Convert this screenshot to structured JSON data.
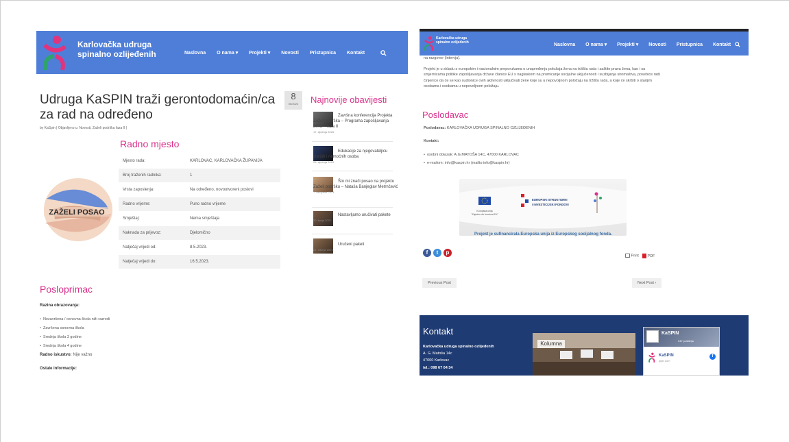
{
  "left": {
    "brand": {
      "line1": "Karlovačka udruga",
      "line2": "spinalno ozlijeđenih"
    },
    "nav": [
      "Naslovna",
      "O nama ▾",
      "Projekti ▾",
      "Novosti",
      "Pristupnica",
      "Kontakt"
    ],
    "title": "Udruga KaSPIN traži gerontodomaćin/ca za rad na određeno",
    "date_day": "8",
    "date_month": "05/2023",
    "meta": "by KaSpin | Objavljeno u: Novosti, Zaželi podrška faza II |",
    "section1": "Radno mjesto",
    "zazeli": "ZAŽELI POSAO",
    "table": [
      {
        "k": "Mjesto rada:",
        "v": "KARLOVAC, KARLOVAČKA ŽUPANIJA"
      },
      {
        "k": "Broj traženih radnika:",
        "v": "1"
      },
      {
        "k": "Vrsta zaposlenja:",
        "v": "Na određeno, novootvoreni poslovi"
      },
      {
        "k": "Radno vrijeme:",
        "v": "Puno radno vrijeme"
      },
      {
        "k": "Smještaj:",
        "v": "Nema smještaja"
      },
      {
        "k": "Naknada za prijevoz:",
        "v": "Djelomično"
      },
      {
        "k": "Natječaj vrijedi od:",
        "v": "8.5.2023."
      },
      {
        "k": "Natječaj vrijedi do:",
        "v": "16.5.2023."
      }
    ],
    "sidebar_title": "Najnovije obavijesti",
    "sidebar": [
      {
        "text": "Završna konferencija Projekta Zaželi podrška – Programa zapošljavanja žena – faza II",
        "date": "17. siječnja 2023."
      },
      {
        "text": "Edukacije za njegovateljicu starijih i nemoćnih osoba",
        "date": "25. siječnja 2023."
      },
      {
        "text": "Što mi znači posao na projektu Zaželi podršku – Nataša Banjeglav Metrnčević",
        "date": "7. listopada 2021."
      },
      {
        "text": "Nastavljamo uručivati pakete",
        "date": "20. lipnja 2021."
      },
      {
        "text": "Uručeni paketi",
        "date": "21. travnja 2021."
      }
    ],
    "section2": "Posloprimac",
    "edu_label": "Razina obrazovanja:",
    "edu": [
      "Nezavršena / osnovna škola niži razredi",
      "Završena osnovna škola",
      "Srednja škola 3 godine",
      "Srednja škola 4 godine"
    ],
    "exp_label": "Radno iskustvo:",
    "exp_value": " Nije važno",
    "other_label": "Ostale informacije:"
  },
  "right": {
    "brand": {
      "line1": "Karlovačka udruga",
      "line2": "spinalno ozlijeđenih"
    },
    "nav": [
      "Naslovna",
      "O nama ▾",
      "Projekti ▾",
      "Novosti",
      "Pristupnica",
      "Kontakt"
    ],
    "intro_tail": "na razgovor (intervju).",
    "paragraph": "Projekt je u skladu s europskim i nacionalnim preporukama o unapređenju položaja žena na tržištu rada i zaštite prava žena, kao i sa smjernicama politike zapošljavanja države članice EU s naglaskom na promicanje socijalne uključenosti i suzbijanja siromaštva, posebice radi činjenice da će se kao sudionice ovih aktivnosti uključivati žene koje su u nepovoljnom položaju na tržištu rada, a koje će skrbiti o starijim osobama i osobama u nepovoljnom položaju.",
    "section": "Poslodavac",
    "employer_label": "Poslodavac:",
    "employer": " KARLOVAČKA UDRUGA SPINALNO OZLIJEĐENIH",
    "contact_label": "Kontakt:",
    "contacts": [
      "osobni dolazak: A.G.MATOŠA 14C, 47000 KARLOVAC",
      "e-mailom: info@kaspin.hr (mailto:info@kaspin.hr)"
    ],
    "eu_text1": "Europska unija",
    "eu_text2": "\"Zajedno do fondova EU\"",
    "esi_text1": "EUROPSKI STRUKTURNI",
    "esi_text2": "I INVESTICIJSKI FONDOVI",
    "caption": "Projekt je sufinancirala Europska unija iz Europskog socijalnog fonda.",
    "print": "Print",
    "pdf": "PDF",
    "prev": "Previous Post",
    "next": "Next Post ›",
    "footer": {
      "title": "Kontakt",
      "org": "Karlovačka udruga spinalno ozlijeđenih",
      "addr1": "A. G. Matoša 14c",
      "addr2": "47000 Karlovac",
      "tel": "tel.: 098 67 04 34",
      "kolumna": "Kolumna",
      "fb_name": "KaSPIN",
      "fb_likes": "347 pratitelja",
      "fb_post_name": "KaSPIN",
      "fb_post_time": "prije 23 h"
    }
  },
  "colors": {
    "header": "#4f7ed8",
    "accent": "#d9328c",
    "footer": "#1f3b73"
  }
}
